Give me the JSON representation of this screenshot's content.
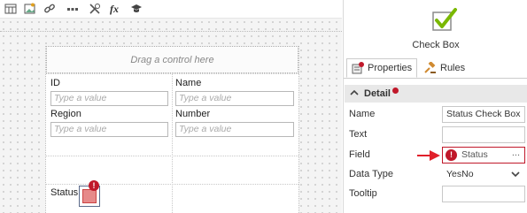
{
  "toolbar": {
    "icons": [
      "table-icon",
      "image-icon",
      "link-icon",
      "more-icon",
      "rule-icon",
      "expression-icon",
      "graduation-cap-icon"
    ],
    "expression_label": "fx"
  },
  "form": {
    "drag_hint": "Drag a control here",
    "fields": [
      {
        "label": "ID",
        "placeholder": "Type a value"
      },
      {
        "label": "Name",
        "placeholder": "Type a value"
      },
      {
        "label": "Region",
        "placeholder": "Type a value"
      },
      {
        "label": "Number",
        "placeholder": "Type a value"
      }
    ],
    "status_label": "Status",
    "status_badge": "!"
  },
  "panel": {
    "control_name": "Check Box",
    "tabs": [
      {
        "label": "Properties",
        "active": true
      },
      {
        "label": "Rules",
        "active": false
      }
    ],
    "section": "Detail",
    "properties": [
      {
        "label": "Name",
        "value": "Status Check Box"
      },
      {
        "label": "Text",
        "value": ""
      },
      {
        "label": "Field",
        "value": "Status",
        "error": "!"
      },
      {
        "label": "Data Type",
        "value": "YesNo"
      },
      {
        "label": "Tooltip",
        "value": ""
      }
    ],
    "ellipsis": "..."
  },
  "colors": {
    "error": "#c0182a",
    "check_green": "#7ab800",
    "arrow_red": "#e0202a"
  }
}
